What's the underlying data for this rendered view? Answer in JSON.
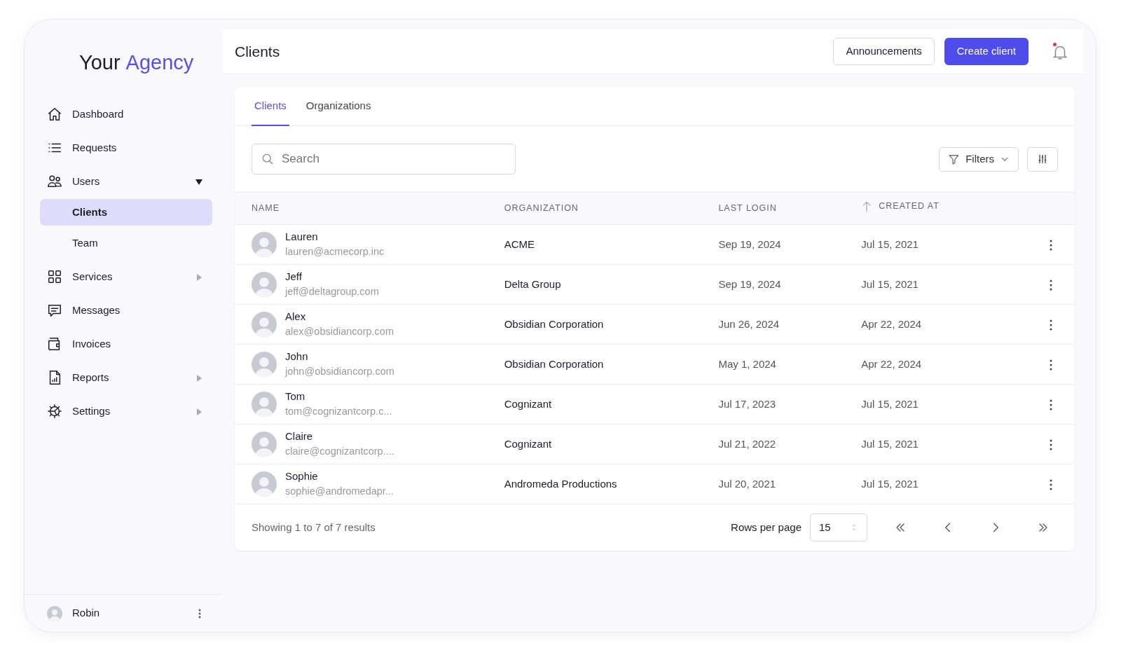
{
  "sidebar": {
    "logo": {
      "first": "Your",
      "second": "Agency"
    },
    "items": [
      {
        "label": "Dashboard",
        "selected": false
      },
      {
        "label": "Requests",
        "selected": false
      },
      {
        "label": "Users",
        "selected": false,
        "expanded": true,
        "children": [
          {
            "label": "Clients",
            "selected": true
          },
          {
            "label": "Team",
            "selected": false
          }
        ]
      },
      {
        "label": "Services",
        "selected": false,
        "expanded": false
      },
      {
        "label": "Messages",
        "selected": false
      },
      {
        "label": "Invoices",
        "selected": false
      },
      {
        "label": "Reports",
        "selected": false,
        "expanded": false
      },
      {
        "label": "Settings",
        "selected": false,
        "expanded": false
      }
    ],
    "user": {
      "name": "Robin"
    }
  },
  "header": {
    "title": "Clients",
    "buttons": [
      {
        "label": "Announcements",
        "kind": "secondary"
      },
      {
        "label": "Create client",
        "kind": "primary"
      }
    ],
    "notifications": {
      "unread": true
    }
  },
  "tabs": [
    {
      "label": "Clients",
      "selected": true
    },
    {
      "label": "Organizations",
      "selected": false
    }
  ],
  "search": {
    "placeholder": "Search"
  },
  "filters_button": "Filters",
  "table": {
    "columns": [
      {
        "label": "NAME",
        "sorted": false
      },
      {
        "label": "ORGANIZATION",
        "sorted": false
      },
      {
        "label": "LAST LOGIN",
        "sorted": false
      },
      {
        "label": "CREATED AT",
        "sorted": true
      }
    ],
    "rows": [
      {
        "name": "Lauren",
        "email": "lauren@acmecorp.inc",
        "organization": "ACME",
        "last_login": "Sep 19, 2024",
        "created_at": "Jul 15, 2021"
      },
      {
        "name": "Jeff",
        "email": "jeff@deltagroup.com",
        "organization": "Delta Group",
        "last_login": "Sep 19, 2024",
        "created_at": "Jul 15, 2021"
      },
      {
        "name": "Alex",
        "email": "alex@obsidiancorp.com",
        "organization": "Obsidian Corporation",
        "last_login": "Jun 26, 2024",
        "created_at": "Apr 22, 2024"
      },
      {
        "name": "John",
        "email": "john@obsidiancorp.com",
        "organization": "Obsidian Corporation",
        "last_login": "May 1, 2024",
        "created_at": "Apr 22, 2024"
      },
      {
        "name": "Tom",
        "email": "tom@cognizantcorp.c...",
        "organization": "Cognizant",
        "last_login": "Jul 17, 2023",
        "created_at": "Jul 15, 2021"
      },
      {
        "name": "Claire",
        "email": "claire@cognizantcorp....",
        "organization": "Cognizant",
        "last_login": "Jul 21, 2022",
        "created_at": "Jul 15, 2021"
      },
      {
        "name": "Sophie",
        "email": "sophie@andromedapr...",
        "organization": "Andromeda Productions",
        "last_login": "Jul 20, 2021",
        "created_at": "Jul 15, 2021"
      }
    ]
  },
  "footer": {
    "summary": "Showing 1 to 7 of 7 results",
    "rows_per_page_label": "Rows per page",
    "rows_per_page": "15"
  }
}
